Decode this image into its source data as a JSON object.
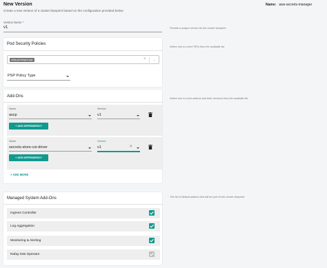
{
  "header": {
    "title": "New Version",
    "subtitle": "Create a new version of a cluster blueprint based on the configuration provided below",
    "name_label": "Name:",
    "name_value": "aws-secrets-manager"
  },
  "version": {
    "label": "Version Name *",
    "value": "v1",
    "hint": "Provide a unique version for the cluster blueprint"
  },
  "psp": {
    "title": "Pod Security Policies",
    "hint": "Select one or more PSPs from the available list",
    "chip": "rafay-privileged-psp",
    "policy_type_label": "PSP Policy Type"
  },
  "addons": {
    "title": "Add-Ons",
    "hint": "Select one or more addons and their versions from the available list",
    "name_label": "Name",
    "version_label": "Version",
    "rows": [
      {
        "name": "ascp",
        "version": "v1"
      },
      {
        "name": "secrets-store-csi-driver",
        "version": "v1"
      }
    ],
    "add_dependency_label": "+ ADD DEPENDENCY",
    "add_more_label": "+ ADD MORE"
  },
  "msa": {
    "title": "Managed System Add-Ons",
    "hint": "The list of default addons that will be part of this cluster blueprint",
    "items": [
      {
        "label": "Ingress Controller",
        "checked": true,
        "disabled": false
      },
      {
        "label": "Log Aggregation",
        "checked": true,
        "disabled": false
      },
      {
        "label": "Monitoring & Alerting",
        "checked": true,
        "disabled": false
      },
      {
        "label": "Rafay K8s Operator",
        "checked": true,
        "disabled": true
      }
    ]
  },
  "colors": {
    "accent": "#11998e",
    "disabled": "#bdbdbd"
  }
}
